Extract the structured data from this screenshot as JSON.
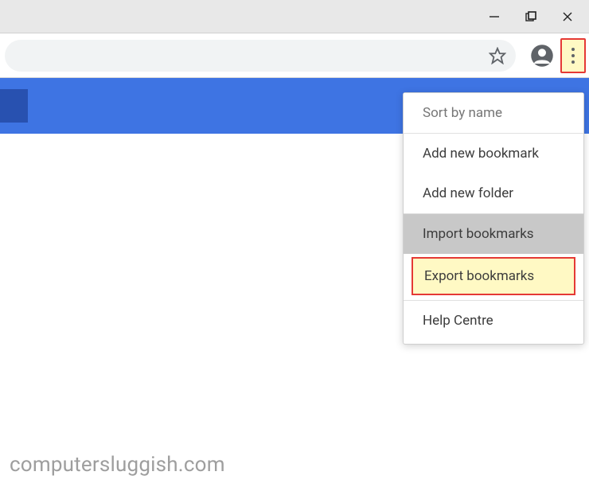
{
  "window": {
    "minimize_icon": "minimize-icon",
    "maximize_icon": "maximize-icon",
    "close_icon": "close-icon"
  },
  "toolbar": {
    "star_icon": "star-icon",
    "profile_icon": "profile-icon",
    "menu_icon": "kebab-icon"
  },
  "menu": {
    "sort": "Sort by name",
    "add_bookmark": "Add new bookmark",
    "add_folder": "Add new folder",
    "import": "Import bookmarks",
    "export": "Export bookmarks",
    "help": "Help Centre"
  },
  "watermark": "computersluggish.com"
}
